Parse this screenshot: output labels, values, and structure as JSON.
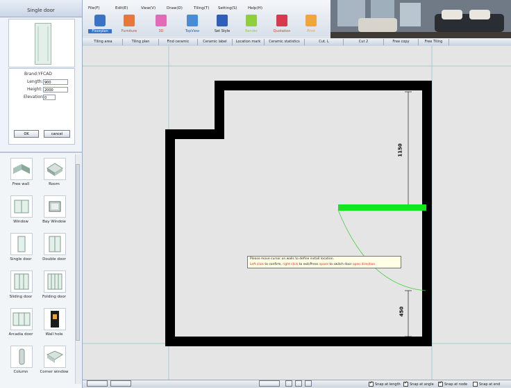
{
  "left_panel": {
    "title": "Single door",
    "properties": {
      "brand": "Brand:YFCAD",
      "length_label": "Length:",
      "length_value": "900",
      "height_label": "Height:",
      "height_value": "2000",
      "elevation_label": "Elevation:",
      "elevation_value": "0"
    },
    "ok_label": "OK",
    "cancel_label": "cancel"
  },
  "library": {
    "items": [
      {
        "label": "Free wall"
      },
      {
        "label": "Room"
      },
      {
        "label": "Window"
      },
      {
        "label": "Bay Window"
      },
      {
        "label": "Single door"
      },
      {
        "label": "Double door"
      },
      {
        "label": "Sliding door"
      },
      {
        "label": "Folding door"
      },
      {
        "label": "Arcadia door"
      },
      {
        "label": "Wall hole"
      },
      {
        "label": "Column"
      },
      {
        "label": "Corner window"
      }
    ]
  },
  "menu": {
    "items": [
      "File(F)",
      "Edit(E)",
      "View(V)",
      "Draw(D)",
      "Tiling(T)",
      "Setting(S)",
      "Help(H)"
    ]
  },
  "toolbar": {
    "tools": [
      {
        "label": "Floorplan",
        "icon": "floorplan-icon",
        "color": "#3a72c4"
      },
      {
        "label": "Furniture",
        "icon": "furniture-icon",
        "color": "#e8773a"
      },
      {
        "label": "3D",
        "icon": "3d-icon",
        "color": "#e46ab8"
      },
      {
        "label": "TopView",
        "icon": "topview-icon",
        "color": "#4a8bd6"
      },
      {
        "label": "Set Style",
        "icon": "set-style-icon",
        "color": "#2f5fb8"
      },
      {
        "label": "Render",
        "icon": "render-icon",
        "color": "#8fcf3c"
      },
      {
        "label": "Quotation",
        "icon": "quotation-icon",
        "color": "#d8394e"
      },
      {
        "label": "Print",
        "icon": "print-icon",
        "color": "#f0a640"
      }
    ]
  },
  "subtabs": [
    "Tiling area",
    "Tiling plan",
    "Find ceramic",
    "Ceramic label",
    "Location mark",
    "Ceramic statistics",
    "Cut. L",
    "Cut 2",
    "Free copy",
    "Free Tiling"
  ],
  "canvas": {
    "dimension_top": "1150",
    "dimension_bottom": "450",
    "tooltip_line1": "Please move cursor on walls to define install location.",
    "tooltip_left": "Left click",
    "tooltip_t1": " to confirm, ",
    "tooltip_right": "right click",
    "tooltip_t2": " to exit/Press ",
    "tooltip_space": "space",
    "tooltip_t3": " to switch door ",
    "tooltip_open": "open direction",
    "door_color": "#14e61c",
    "wall_color": "#000000"
  },
  "statusbar": {
    "snap_length": "Snap at length",
    "snap_angle": "Snap at angle",
    "snap_node": "Snap at node",
    "snap_end": "Snap at end"
  }
}
